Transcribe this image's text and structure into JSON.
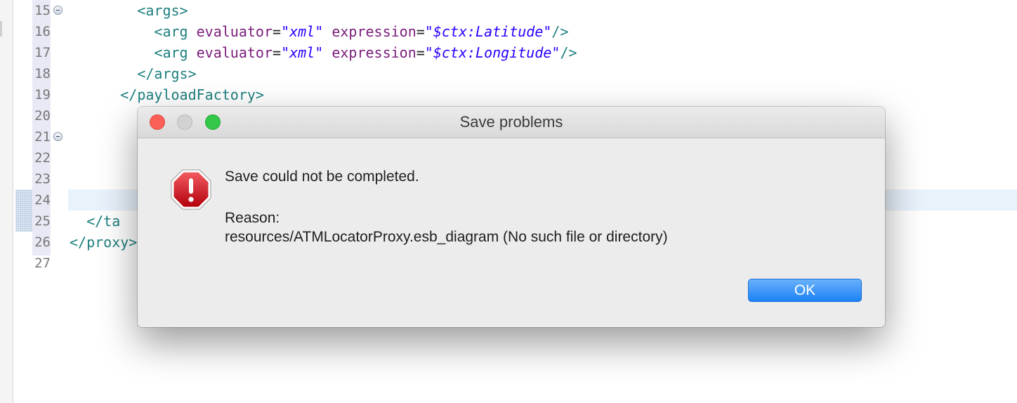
{
  "editor": {
    "lines": [
      {
        "num": "15",
        "indent": "        ",
        "foldable": true,
        "parts": [
          {
            "k": "tag",
            "t": "<args>"
          }
        ]
      },
      {
        "num": "16",
        "indent": "          ",
        "foldable": false,
        "parts": [
          {
            "k": "tag",
            "t": "<arg "
          },
          {
            "k": "attr",
            "t": "evaluator"
          },
          {
            "k": "eq",
            "t": "="
          },
          {
            "k": "val",
            "t": "\"xml\""
          },
          {
            "k": "eq",
            "t": " "
          },
          {
            "k": "attr",
            "t": "expression"
          },
          {
            "k": "eq",
            "t": "="
          },
          {
            "k": "val",
            "t": "\"$ctx:Latitude\""
          },
          {
            "k": "tag",
            "t": "/>"
          }
        ]
      },
      {
        "num": "17",
        "indent": "          ",
        "foldable": false,
        "parts": [
          {
            "k": "tag",
            "t": "<arg "
          },
          {
            "k": "attr",
            "t": "evaluator"
          },
          {
            "k": "eq",
            "t": "="
          },
          {
            "k": "val",
            "t": "\"xml\""
          },
          {
            "k": "eq",
            "t": " "
          },
          {
            "k": "attr",
            "t": "expression"
          },
          {
            "k": "eq",
            "t": "="
          },
          {
            "k": "val",
            "t": "\"$ctx:Longitude\""
          },
          {
            "k": "tag",
            "t": "/>"
          }
        ]
      },
      {
        "num": "18",
        "indent": "        ",
        "foldable": false,
        "parts": [
          {
            "k": "tag",
            "t": "</args>"
          }
        ]
      },
      {
        "num": "19",
        "indent": "      ",
        "foldable": false,
        "parts": [
          {
            "k": "tag",
            "t": "</payloadFactory>"
          }
        ]
      },
      {
        "num": "20",
        "indent": "",
        "foldable": false,
        "parts": []
      },
      {
        "num": "21",
        "indent": "",
        "foldable": true,
        "parts": []
      },
      {
        "num": "22",
        "indent": "",
        "foldable": false,
        "parts": []
      },
      {
        "num": "23",
        "indent": "",
        "foldable": false,
        "parts": []
      },
      {
        "num": "24",
        "indent": "",
        "foldable": false,
        "parts": []
      },
      {
        "num": "25",
        "indent": "  ",
        "foldable": false,
        "parts": [
          {
            "k": "tag",
            "t": "</ta"
          }
        ]
      },
      {
        "num": "26",
        "indent": "",
        "foldable": false,
        "parts": [
          {
            "k": "tag",
            "t": "</proxy>"
          }
        ]
      },
      {
        "num": "27",
        "indent": "",
        "foldable": false,
        "parts": []
      }
    ]
  },
  "dialog": {
    "title": "Save problems",
    "message": "Save could not be completed.",
    "reason_label": "Reason:",
    "reason_detail": "resources/ATMLocatorProxy.esb_diagram (No such file or directory)",
    "ok_label": "OK",
    "icon": "error-stop-icon",
    "colors": {
      "close": "#fc5f57",
      "minimize": "#d2d2d2",
      "zoom": "#33c748",
      "ok_button": "#1b82f6",
      "error_icon": "#d0121b"
    }
  }
}
